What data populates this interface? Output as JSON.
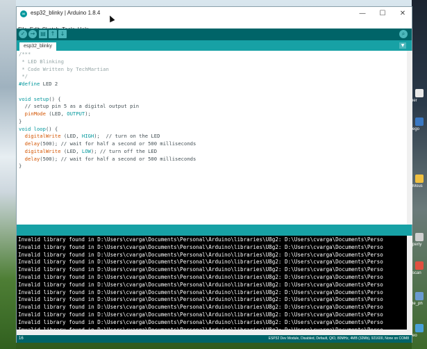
{
  "window": {
    "title": "esp32_blinky | Arduino 1.8.4",
    "minimize_glyph": "—",
    "maximize_glyph": "☐",
    "close_glyph": "✕"
  },
  "menu": [
    "File",
    "Edit",
    "Sketch",
    "Tools",
    "Help"
  ],
  "toolbar": {
    "verify_icon": "checkmark-icon",
    "upload_icon": "arrow-right-icon",
    "new_icon": "new-file-icon",
    "open_icon": "arrow-up-icon",
    "save_icon": "arrow-down-icon",
    "serial_monitor_icon": "magnifier-icon",
    "verify_glyph": "✓",
    "upload_glyph": "→",
    "new_glyph": "▤",
    "open_glyph": "↑",
    "save_glyph": "↓",
    "serial_glyph": "⌕"
  },
  "tabs": [
    {
      "label": "esp32_blinky"
    }
  ],
  "tab_menu_glyph": "▼",
  "editor": {
    "lines": [
      [
        {
          "t": "/***",
          "c": "comment"
        }
      ],
      [
        {
          "t": " * LED Blinking",
          "c": "comment"
        }
      ],
      [
        {
          "t": " * Code Written by TechMartian",
          "c": "comment"
        }
      ],
      [
        {
          "t": " */",
          "c": "comment"
        }
      ],
      [
        {
          "t": "#define",
          "c": "keyword"
        },
        {
          "t": " LED 2",
          "c": "plain"
        }
      ],
      [
        {
          "t": "",
          "c": "plain"
        }
      ],
      [
        {
          "t": "void",
          "c": "type"
        },
        {
          "t": " ",
          "c": "plain"
        },
        {
          "t": "setup",
          "c": "keyword"
        },
        {
          "t": "() {",
          "c": "plain"
        }
      ],
      [
        {
          "t": "  // setup pin 5 as a digital output pin",
          "c": "plain"
        }
      ],
      [
        {
          "t": "  ",
          "c": "plain"
        },
        {
          "t": "pinMode",
          "c": "func"
        },
        {
          "t": " (LED, ",
          "c": "plain"
        },
        {
          "t": "OUTPUT",
          "c": "const"
        },
        {
          "t": ");",
          "c": "plain"
        }
      ],
      [
        {
          "t": "}",
          "c": "plain"
        }
      ],
      [
        {
          "t": "void",
          "c": "type"
        },
        {
          "t": " ",
          "c": "plain"
        },
        {
          "t": "loop",
          "c": "keyword"
        },
        {
          "t": "() {",
          "c": "plain"
        }
      ],
      [
        {
          "t": "  ",
          "c": "plain"
        },
        {
          "t": "digitalWrite",
          "c": "func"
        },
        {
          "t": " (LED, ",
          "c": "plain"
        },
        {
          "t": "HIGH",
          "c": "const"
        },
        {
          "t": ");  // turn on the LED",
          "c": "plain"
        }
      ],
      [
        {
          "t": "  ",
          "c": "plain"
        },
        {
          "t": "delay",
          "c": "func"
        },
        {
          "t": "(500); // wait for half a second or 500 milliseconds",
          "c": "plain"
        }
      ],
      [
        {
          "t": "  ",
          "c": "plain"
        },
        {
          "t": "digitalWrite",
          "c": "func"
        },
        {
          "t": " (LED, ",
          "c": "plain"
        },
        {
          "t": "LOW",
          "c": "const"
        },
        {
          "t": "); // turn off the LED",
          "c": "plain"
        }
      ],
      [
        {
          "t": "  ",
          "c": "plain"
        },
        {
          "t": "delay",
          "c": "func"
        },
        {
          "t": "(500); // wait for half a second or 500 milliseconds",
          "c": "plain"
        }
      ],
      [
        {
          "t": "}",
          "c": "plain"
        }
      ]
    ]
  },
  "console": {
    "lines": [
      "Invalid library found in D:\\Users\\cvarga\\Documents\\Personal\\Arduino\\libraries\\U8g2: D:\\Users\\cvarga\\Documents\\Perso",
      "Invalid library found in D:\\Users\\cvarga\\Documents\\Personal\\Arduino\\libraries\\U8g2: D:\\Users\\cvarga\\Documents\\Perso",
      "Invalid library found in D:\\Users\\cvarga\\Documents\\Personal\\Arduino\\libraries\\U8g2: D:\\Users\\cvarga\\Documents\\Perso",
      "Invalid library found in D:\\Users\\cvarga\\Documents\\Personal\\Arduino\\libraries\\U8g2: D:\\Users\\cvarga\\Documents\\Perso",
      "Invalid library found in D:\\Users\\cvarga\\Documents\\Personal\\Arduino\\libraries\\U8g2: D:\\Users\\cvarga\\Documents\\Perso",
      "Invalid library found in D:\\Users\\cvarga\\Documents\\Personal\\Arduino\\libraries\\U8g2: D:\\Users\\cvarga\\Documents\\Perso",
      "Invalid library found in D:\\Users\\cvarga\\Documents\\Personal\\Arduino\\libraries\\U8g2: D:\\Users\\cvarga\\Documents\\Perso",
      "Invalid library found in D:\\Users\\cvarga\\Documents\\Personal\\Arduino\\libraries\\U8g2: D:\\Users\\cvarga\\Documents\\Perso",
      "Invalid library found in D:\\Users\\cvarga\\Documents\\Personal\\Arduino\\libraries\\U8g2: D:\\Users\\cvarga\\Documents\\Perso",
      "Invalid library found in D:\\Users\\cvarga\\Documents\\Personal\\Arduino\\libraries\\U8g2: D:\\Users\\cvarga\\Documents\\Perso",
      "Invalid library found in D:\\Users\\cvarga\\Documents\\Personal\\Arduino\\libraries\\U8g2: D:\\Users\\cvarga\\Documents\\Perso",
      "Invalid library found in D:\\Users\\cvarga\\Documents\\Personal\\Arduino\\libraries\\U8g2: D:\\Users\\cvarga\\Documents\\Perso",
      "Invalid library found in D:\\Users\\cvarga\\Documents\\Personal\\Arduino\\libraries\\U8g2: D:\\Users\\cvarga\\Documents\\Perso"
    ]
  },
  "footer": {
    "line_number": "16",
    "board_info": "ESP32 Dev Module, Disabled, Default, QIO, 80MHz, 4MB (32Mb), 921600, None on COM8"
  },
  "desktop": {
    "labels": [
      "ier",
      "ego",
      "Mous",
      "perty",
      "scan",
      "le_ph",
      "eo"
    ]
  },
  "colors": {
    "toolbar": "#006468",
    "tabbar": "#17a1a5",
    "console_bg": "#000000",
    "keyword": "#00979c",
    "function": "#d35400",
    "comment": "#95a5a6"
  }
}
